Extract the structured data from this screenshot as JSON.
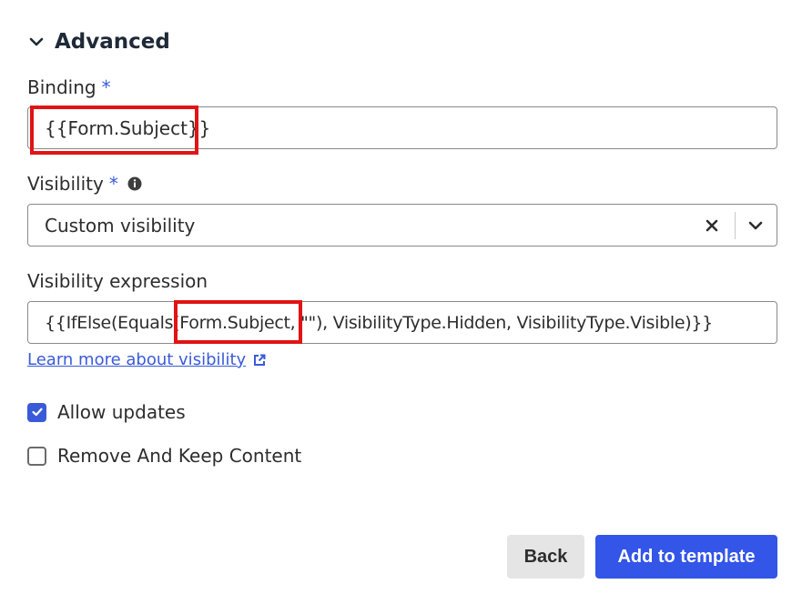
{
  "advanced": {
    "title": "Advanced",
    "icon": "chevron-down-icon"
  },
  "binding": {
    "label": "Binding",
    "required_marker": "*",
    "value": "{{Form.Subject}}"
  },
  "visibility": {
    "label": "Visibility",
    "required_marker": "*",
    "info_icon": "info-icon",
    "selected": "Custom visibility",
    "clear_icon": "close-icon",
    "dropdown_icon": "chevron-down-icon"
  },
  "visibility_expression": {
    "label": "Visibility expression",
    "value": "{{IfElse(Equals(Form.Subject, \"\"), VisibilityType.Hidden, VisibilityType.Visible)}}"
  },
  "learn_more": {
    "text": "Learn more about visibility",
    "icon": "external-link-icon"
  },
  "options": {
    "allow_updates": {
      "label": "Allow updates",
      "checked": true
    },
    "remove_keep": {
      "label": "Remove And Keep Content",
      "checked": false
    }
  },
  "actions": {
    "back_label": "Back",
    "add_label": "Add to template"
  },
  "colors": {
    "accent": "#3355e8",
    "highlight": "#e01414"
  }
}
